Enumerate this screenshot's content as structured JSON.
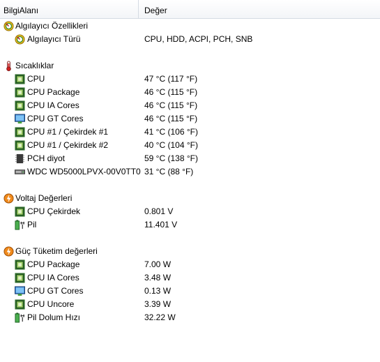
{
  "header": {
    "col_field": "BilgiAlanı",
    "col_value": "Değer"
  },
  "sections": [
    {
      "title": "Algılayıcı Özellikleri",
      "icon": "sensor-gauge-icon",
      "items": [
        {
          "label": "Algılayıcı Türü",
          "value": "CPU, HDD, ACPI, PCH, SNB",
          "icon": "sensor-gauge-icon"
        }
      ]
    },
    {
      "title": "Sıcaklıklar",
      "icon": "thermometer-icon",
      "items": [
        {
          "label": "CPU",
          "value": "47 °C  (117 °F)",
          "icon": "cpu-chip-icon"
        },
        {
          "label": "CPU Package",
          "value": "46 °C  (115 °F)",
          "icon": "cpu-chip-icon"
        },
        {
          "label": "CPU IA Cores",
          "value": "46 °C  (115 °F)",
          "icon": "cpu-chip-icon"
        },
        {
          "label": "CPU GT Cores",
          "value": "46 °C  (115 °F)",
          "icon": "gpu-monitor-icon"
        },
        {
          "label": "CPU #1 / Çekirdek #1",
          "value": "41 °C  (106 °F)",
          "icon": "cpu-chip-icon"
        },
        {
          "label": "CPU #1 / Çekirdek #2",
          "value": "40 °C  (104 °F)",
          "icon": "cpu-chip-icon"
        },
        {
          "label": "PCH diyot",
          "value": "59 °C  (138 °F)",
          "icon": "pch-chip-icon"
        },
        {
          "label": "WDC WD5000LPVX-00V0TT0",
          "value": "31 °C  (88 °F)",
          "icon": "hard-drive-icon"
        }
      ]
    },
    {
      "title": "Voltaj Değerleri",
      "icon": "voltage-bolt-icon",
      "items": [
        {
          "label": "CPU Çekirdek",
          "value": "0.801 V",
          "icon": "cpu-chip-icon"
        },
        {
          "label": "Pil",
          "value": "11.401 V",
          "icon": "battery-plug-icon"
        }
      ]
    },
    {
      "title": "Güç Tüketim değerleri",
      "icon": "power-bolt-icon",
      "items": [
        {
          "label": "CPU Package",
          "value": "7.00 W",
          "icon": "cpu-chip-icon"
        },
        {
          "label": "CPU IA Cores",
          "value": "3.48 W",
          "icon": "cpu-chip-icon"
        },
        {
          "label": "CPU GT Cores",
          "value": "0.13 W",
          "icon": "gpu-monitor-icon"
        },
        {
          "label": "CPU Uncore",
          "value": "3.39 W",
          "icon": "cpu-chip-icon"
        },
        {
          "label": "Pil Dolum Hızı",
          "value": "32.22 W",
          "icon": "battery-plug-icon"
        }
      ]
    }
  ]
}
